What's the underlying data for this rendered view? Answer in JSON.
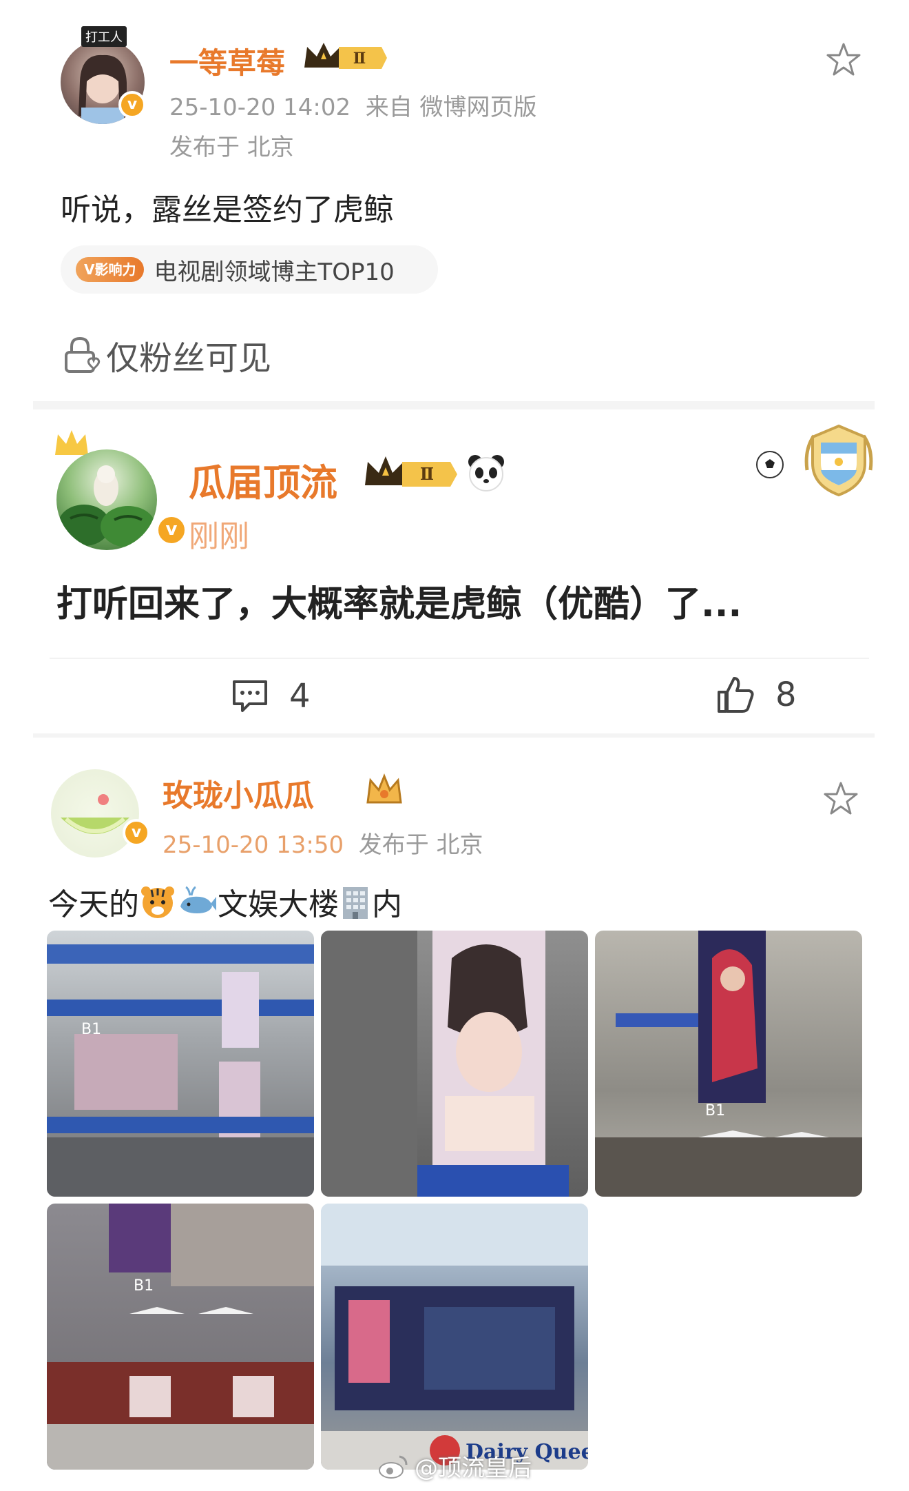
{
  "post1": {
    "username": "一等草莓",
    "level": "Ⅱ",
    "avatar_caption": "打工人",
    "timestamp": "25-10-20 14:02",
    "source": "来自 微博网页版",
    "location": "发布于 北京",
    "text": "听说，露丝是签约了虎鲸",
    "tag_badge": "V影响力",
    "tag_text": "电视剧领域博主TOP10",
    "fans_only": "仅粉丝可见"
  },
  "post2": {
    "username": "瓜届顶流",
    "level": "Ⅱ",
    "time": "刚刚",
    "text": "打听回来了，大概率就是虎鲸（优酷）了...",
    "comments": "4",
    "likes": "8"
  },
  "post3": {
    "username": "玫珑小瓜瓜",
    "timestamp": "25-10-20 13:50",
    "location": "发布于 北京",
    "text_a": "今天的",
    "text_b": "文娱大楼",
    "text_c": "内",
    "floor_labels": [
      "B1",
      "B1",
      "B1"
    ],
    "sign_text": "Dairy Quee"
  },
  "watermark": "@顶流皇后",
  "colors": {
    "username": "#e8792b",
    "meta": "#9a9a9a",
    "badge": "#f5a623"
  }
}
